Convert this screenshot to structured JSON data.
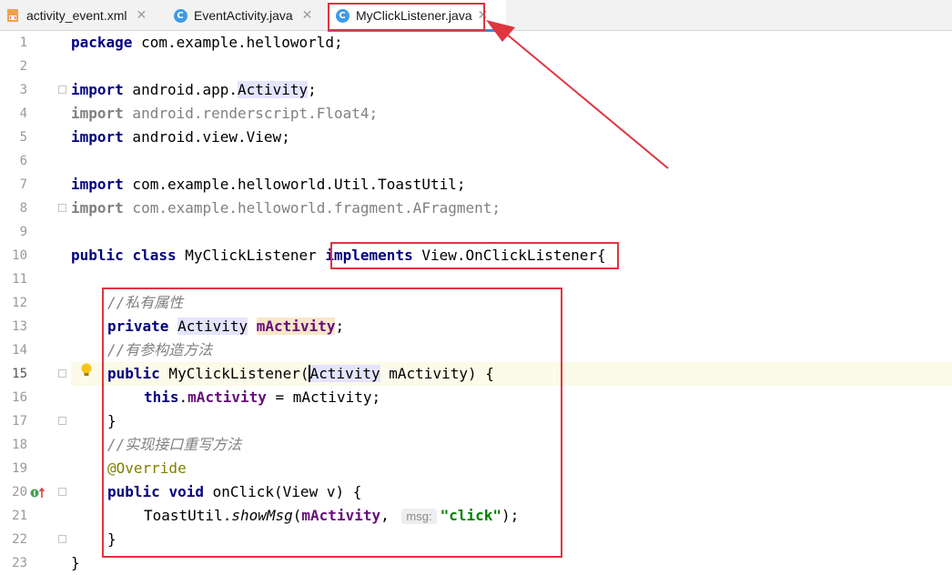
{
  "tabs": [
    {
      "label": "activity_event.xml",
      "icon": "xml-file-icon",
      "active": false
    },
    {
      "label": "EventActivity.java",
      "icon": "java-class-icon",
      "active": false
    },
    {
      "label": "MyClickListener.java",
      "icon": "java-class-icon",
      "active": true
    }
  ],
  "close_glyph": "✕",
  "class_icon_letter": "C",
  "line_numbers": [
    "1",
    "2",
    "3",
    "4",
    "5",
    "6",
    "7",
    "8",
    "9",
    "10",
    "11",
    "12",
    "13",
    "14",
    "15",
    "16",
    "17",
    "18",
    "19",
    "20",
    "21",
    "22",
    "23"
  ],
  "code": {
    "l1": {
      "kw": "package",
      "rest": " com.example.helloworld;"
    },
    "l3": {
      "kw": "import",
      "pre": " android.app.",
      "sym": "Activity",
      "post": ";"
    },
    "l4": {
      "kw": "import",
      "rest": " android.renderscript.Float4;"
    },
    "l5": {
      "kw": "import",
      "rest": " android.view.View;"
    },
    "l7": {
      "kw": "import",
      "rest": " com.example.helloworld.Util.ToastUtil;"
    },
    "l8": {
      "kw": "import",
      "rest": " com.example.helloworld.fragment.AFragment;"
    },
    "l10": {
      "kw1": "public",
      "kw2": "class",
      "name": " MyClickListener ",
      "kw3": "implements",
      "iface": " View.OnClickListener",
      "brace": "{"
    },
    "l12": {
      "comment": "//私有属性"
    },
    "l13": {
      "kw": "private",
      "type": "Activity",
      "field": "mActivity",
      "end": ";"
    },
    "l14": {
      "comment": "//有参构造方法"
    },
    "l15": {
      "kw": "public",
      "name": " MyClickListener(",
      "a": "A",
      "ctype": "ctivity",
      "param": " mActivity) {"
    },
    "l16": {
      "kw": "this",
      "dot": ".",
      "field": "mActivity",
      "rest": " = mActivity;"
    },
    "l17": {
      "rest": "}"
    },
    "l18": {
      "comment": "//实现接口重写方法"
    },
    "l19": {
      "ann": "@Override"
    },
    "l20": {
      "kw1": "public",
      "kw2": "void",
      "rest": " onClick(View v) {"
    },
    "l21": {
      "pre": "ToastUtil.",
      "method": "showMsg",
      "open": "(",
      "field": "mActivity",
      "comma": ",",
      "hint": "msg:",
      "str": "\"click\"",
      "end": ");"
    },
    "l22": {
      "rest": "}"
    },
    "l23": {
      "rest": "}"
    }
  },
  "colors": {
    "annotation_box": "#e0343e",
    "keyword": "#000080",
    "string": "#008000",
    "field": "#660e7a"
  }
}
